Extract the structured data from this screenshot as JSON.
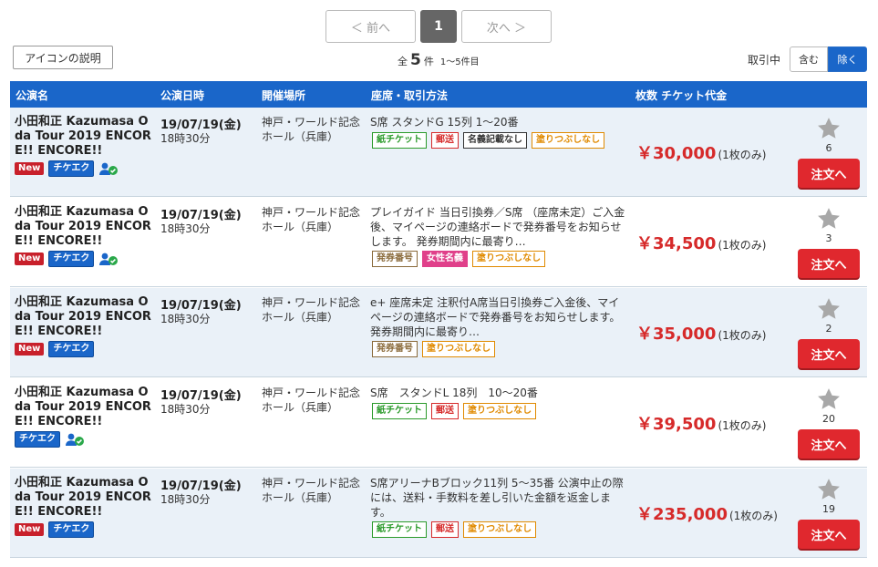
{
  "pagination": {
    "prev": "＜ 前へ",
    "current": "1",
    "next": "次へ ＞"
  },
  "icon_help": "アイコンの説明",
  "count": {
    "prefix": "全",
    "total": "5",
    "suffix": "件",
    "range": "1～5件目"
  },
  "filter": {
    "label": "取引中",
    "include": "含む",
    "exclude": "除く"
  },
  "header": {
    "title": "公演名",
    "date": "公演日時",
    "venue": "開催場所",
    "seat": "座席・取引方法",
    "price": "枚数 チケット代金"
  },
  "badges": {
    "new": "New",
    "chike": "チケエク"
  },
  "colors": {
    "accent": "#1a66c9",
    "price": "#d62a2a",
    "order": "#e0282e"
  },
  "rows": [
    {
      "title": "小田和正 Kazumasa Oda Tour 2019 ENCORE!! ENCORE!!",
      "date": "19/07/19(金)",
      "time": "18時30分",
      "venue": "神戸・ワールド記念ホール（兵庫）",
      "seat": "S席 スタンドG 15列 1～20番",
      "tags": [
        {
          "label": "紙チケット",
          "color": "green"
        },
        {
          "label": "郵送",
          "color": "red"
        },
        {
          "label": "名義記載なし",
          "color": "black"
        },
        {
          "label": "塗りつぶしなし",
          "color": "orange"
        }
      ],
      "price": "￥30,000",
      "unit": "(1枚のみ)",
      "fav": "6",
      "order": "注文へ",
      "new": true,
      "user": true
    },
    {
      "title": "小田和正 Kazumasa Oda Tour 2019 ENCORE!! ENCORE!!",
      "date": "19/07/19(金)",
      "time": "18時30分",
      "venue": "神戸・ワールド記念ホール（兵庫）",
      "seat": "プレイガイド 当日引換券／S席 （座席未定）ご入金後、マイページの連絡ボードで発券番号をお知らせします。 発券期間内に最寄り…",
      "tags": [
        {
          "label": "発券番号",
          "color": "brown"
        },
        {
          "label": "女性名義",
          "color": "pink"
        },
        {
          "label": "塗りつぶしなし",
          "color": "orange"
        }
      ],
      "price": "￥34,500",
      "unit": "(1枚のみ)",
      "fav": "3",
      "order": "注文へ",
      "new": true,
      "user": true
    },
    {
      "title": "小田和正 Kazumasa Oda Tour 2019 ENCORE!! ENCORE!!",
      "date": "19/07/19(金)",
      "time": "18時30分",
      "venue": "神戸・ワールド記念ホール（兵庫）",
      "seat": "e+ 座席未定 注釈付A席当日引換券ご入金後、マイページの連絡ボードで発券番号をお知らせします。 発券期間内に最寄り…",
      "tags": [
        {
          "label": "発券番号",
          "color": "brown"
        },
        {
          "label": "塗りつぶしなし",
          "color": "orange"
        }
      ],
      "price": "￥35,000",
      "unit": "(1枚のみ)",
      "fav": "2",
      "order": "注文へ",
      "new": true,
      "user": false
    },
    {
      "title": "小田和正 Kazumasa Oda Tour 2019 ENCORE!! ENCORE!!",
      "date": "19/07/19(金)",
      "time": "18時30分",
      "venue": "神戸・ワールド記念ホール（兵庫）",
      "seat": "S席　スタンドL 18列　10～20番",
      "tags": [
        {
          "label": "紙チケット",
          "color": "green"
        },
        {
          "label": "郵送",
          "color": "red"
        },
        {
          "label": "塗りつぶしなし",
          "color": "orange"
        }
      ],
      "price": "￥39,500",
      "unit": "(1枚のみ)",
      "fav": "20",
      "order": "注文へ",
      "new": false,
      "user": true
    },
    {
      "title": "小田和正 Kazumasa Oda Tour 2019 ENCORE!! ENCORE!!",
      "date": "19/07/19(金)",
      "time": "18時30分",
      "venue": "神戸・ワールド記念ホール（兵庫）",
      "seat": "S席アリーナBブロック11列 5～35番 公演中止の際には、送料・手数料を差し引いた金額を返金します。",
      "tags": [
        {
          "label": "紙チケット",
          "color": "green"
        },
        {
          "label": "郵送",
          "color": "red"
        },
        {
          "label": "塗りつぶしなし",
          "color": "orange"
        }
      ],
      "price": "￥235,000",
      "unit": "(1枚のみ)",
      "fav": "19",
      "order": "注文へ",
      "new": true,
      "user": false
    }
  ]
}
